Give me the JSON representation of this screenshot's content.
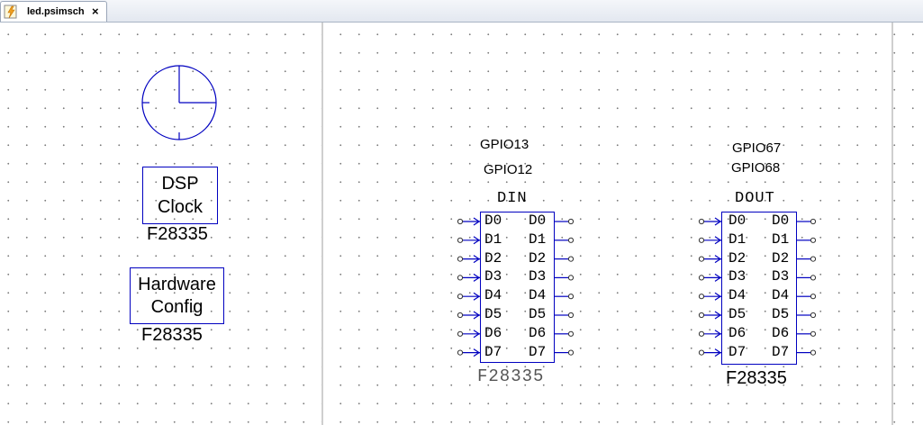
{
  "tab": {
    "label": "led.psimsch",
    "close": "×",
    "icon": "psim-file-icon"
  },
  "colors": {
    "element": "#0000c0",
    "grid_dot": "#7d7d7d",
    "border": "#cfcfcf"
  },
  "blocks": {
    "clock": {
      "icon": "clock-icon"
    },
    "dsp_clock": {
      "line1": "DSP",
      "line2": "Clock",
      "caption": "F28335"
    },
    "hardware_config": {
      "line1": "Hardware",
      "line2": "Config",
      "caption": "F28335"
    }
  },
  "din": {
    "gpio": [
      "GPIO13",
      "GPIO12"
    ],
    "title": "DIN",
    "pins_in": [
      "D0",
      "D1",
      "D2",
      "D3",
      "D4",
      "D5",
      "D6",
      "D7"
    ],
    "pins_out": [
      "D0",
      "D1",
      "D2",
      "D3",
      "D4",
      "D5",
      "D6",
      "D7"
    ],
    "caption": "F28335"
  },
  "dout": {
    "gpio": [
      "GPIO67",
      "GPIO68"
    ],
    "title": "DOUT",
    "pins_in": [
      "D0",
      "D1",
      "D2",
      "D3",
      "D4",
      "D5",
      "D6",
      "D7"
    ],
    "pins_out": [
      "D0",
      "D1",
      "D2",
      "D3",
      "D4",
      "D5",
      "D6",
      "D7"
    ],
    "caption": "F28335"
  }
}
